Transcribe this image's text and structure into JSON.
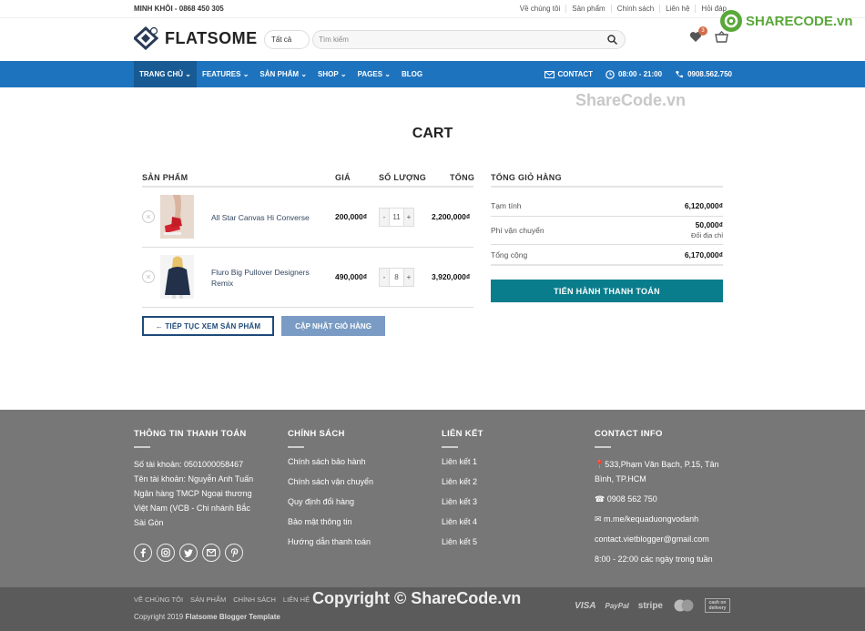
{
  "topbar": {
    "owner": "MINH KHÔI - 0868 450 305",
    "links": [
      "Về chúng tôi",
      "Sản phẩm",
      "Chính sách",
      "Liên hệ",
      "Hỏi đáp"
    ]
  },
  "header": {
    "logo": "FLATSOME",
    "category": "Tất cả",
    "search_placeholder": "Tìm kiếm",
    "wishlist_count": "3"
  },
  "watermark": {
    "top_logo": "SHARECODE.vn",
    "center": "ShareCode.vn",
    "copyright": "Copyright © ShareCode.vn"
  },
  "nav": {
    "items": [
      "TRANG CHỦ",
      "FEATURES",
      "SẢN PHẨM",
      "SHOP",
      "PAGES",
      "BLOG"
    ],
    "contact": "CONTACT",
    "hours": "08:00 - 21:00",
    "phone": "0908.562.750"
  },
  "page": {
    "title": "CART"
  },
  "cart": {
    "headers": {
      "product": "SẢN PHẨM",
      "price": "GIÁ",
      "qty": "SỐ LƯỢNG",
      "total": "TỔNG"
    },
    "items": [
      {
        "name": "All Star Canvas Hi Converse",
        "price": "200,000₫",
        "qty": "11",
        "subtotal": "2,200,000₫"
      },
      {
        "name": "Fluro Big Pullover Designers Remix",
        "price": "490,000₫",
        "qty": "8",
        "subtotal": "3,920,000₫"
      }
    ],
    "continue_label": "← TIẾP TỤC XEM SẢN PHẨM",
    "update_label": "CẬP NHẬT GIỎ HÀNG"
  },
  "totals": {
    "title": "TỔNG GIỎ HÀNG",
    "subtotal_label": "Tạm tính",
    "subtotal": "6,120,000₫",
    "shipping_label": "Phí vận chuyển",
    "shipping": "50,000₫",
    "change_address": "Đổi địa chỉ",
    "total_label": "Tổng cộng",
    "total": "6,170,000₫",
    "checkout_label": "TIẾN HÀNH THANH TOÁN"
  },
  "footer": {
    "col1": {
      "title": "THÔNG TIN THANH TOÁN",
      "text": [
        "Số tài khoản: 0501000058467",
        "Tên tài khoản: Nguyễn Anh Tuấn",
        "Ngân hàng TMCP Ngoại thương",
        "Việt Nam (VCB - Chi nhánh Bắc",
        "Sài Gòn"
      ]
    },
    "col2": {
      "title": "CHÍNH SÁCH",
      "items": [
        "Chính sách bảo hành",
        "Chính sách vận chuyển",
        "Quy định đổi hàng",
        "Bảo mật thông tin",
        "Hướng dẫn thanh toán"
      ]
    },
    "col3": {
      "title": "LIÊN KẾT",
      "items": [
        "Liên kết 1",
        "Liên kết 2",
        "Liên kết 3",
        "Liên kết 4",
        "Liên kết 5"
      ]
    },
    "col4": {
      "title": "CONTACT INFO",
      "address1": "533,Phạm Văn Bạch, P.15, Tân",
      "address2": "Bình, TP.HCM",
      "phone": "0908 562 750",
      "messenger": "m.me/kequaduongvodanh",
      "email": "contact.vietblogger@gmail.com",
      "hours": "8:00 - 22:00 các ngày trong tuần"
    }
  },
  "bottom": {
    "links": [
      "VỀ CHÚNG TÔI",
      "SẢN PHẨM",
      "CHÍNH SÁCH",
      "LIÊN HỆ"
    ],
    "copyright_prefix": "Copyright 2019 ",
    "copyright_brand": "Flatsome Blogger Template",
    "payments": [
      "VISA",
      "PayPal",
      "stripe",
      "mastercard",
      "cash on delivery"
    ]
  }
}
